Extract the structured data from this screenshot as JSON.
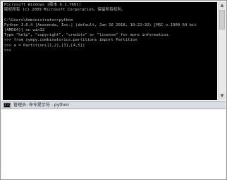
{
  "window": {
    "title": "管理员: 命令提示符 - python",
    "icon": "terminal-icon"
  },
  "console": {
    "lines": [
      "Microsoft Windows [版本 6.1.7601]",
      "版权所有 (c) 2009 Microsoft Corporation。保留所有权利。",
      "",
      "C:\\Users\\Administrator>python",
      "Python 3.6.4 |Anaconda, Inc.| (default, Jan 16 2018, 10:22:32) [MSC v.1900 64 bit (AMD64)] on win32",
      "Type \"help\", \"copyright\", \"credits\" or \"license\" for more information.",
      ">>> from sympy.combinatorics.partitions import Partition",
      ">>> a = Partition([1,2],[3],[4,5])",
      ">>> "
    ]
  },
  "colors": {
    "console_bg": "#000000",
    "console_fg": "#c0c0c0"
  }
}
